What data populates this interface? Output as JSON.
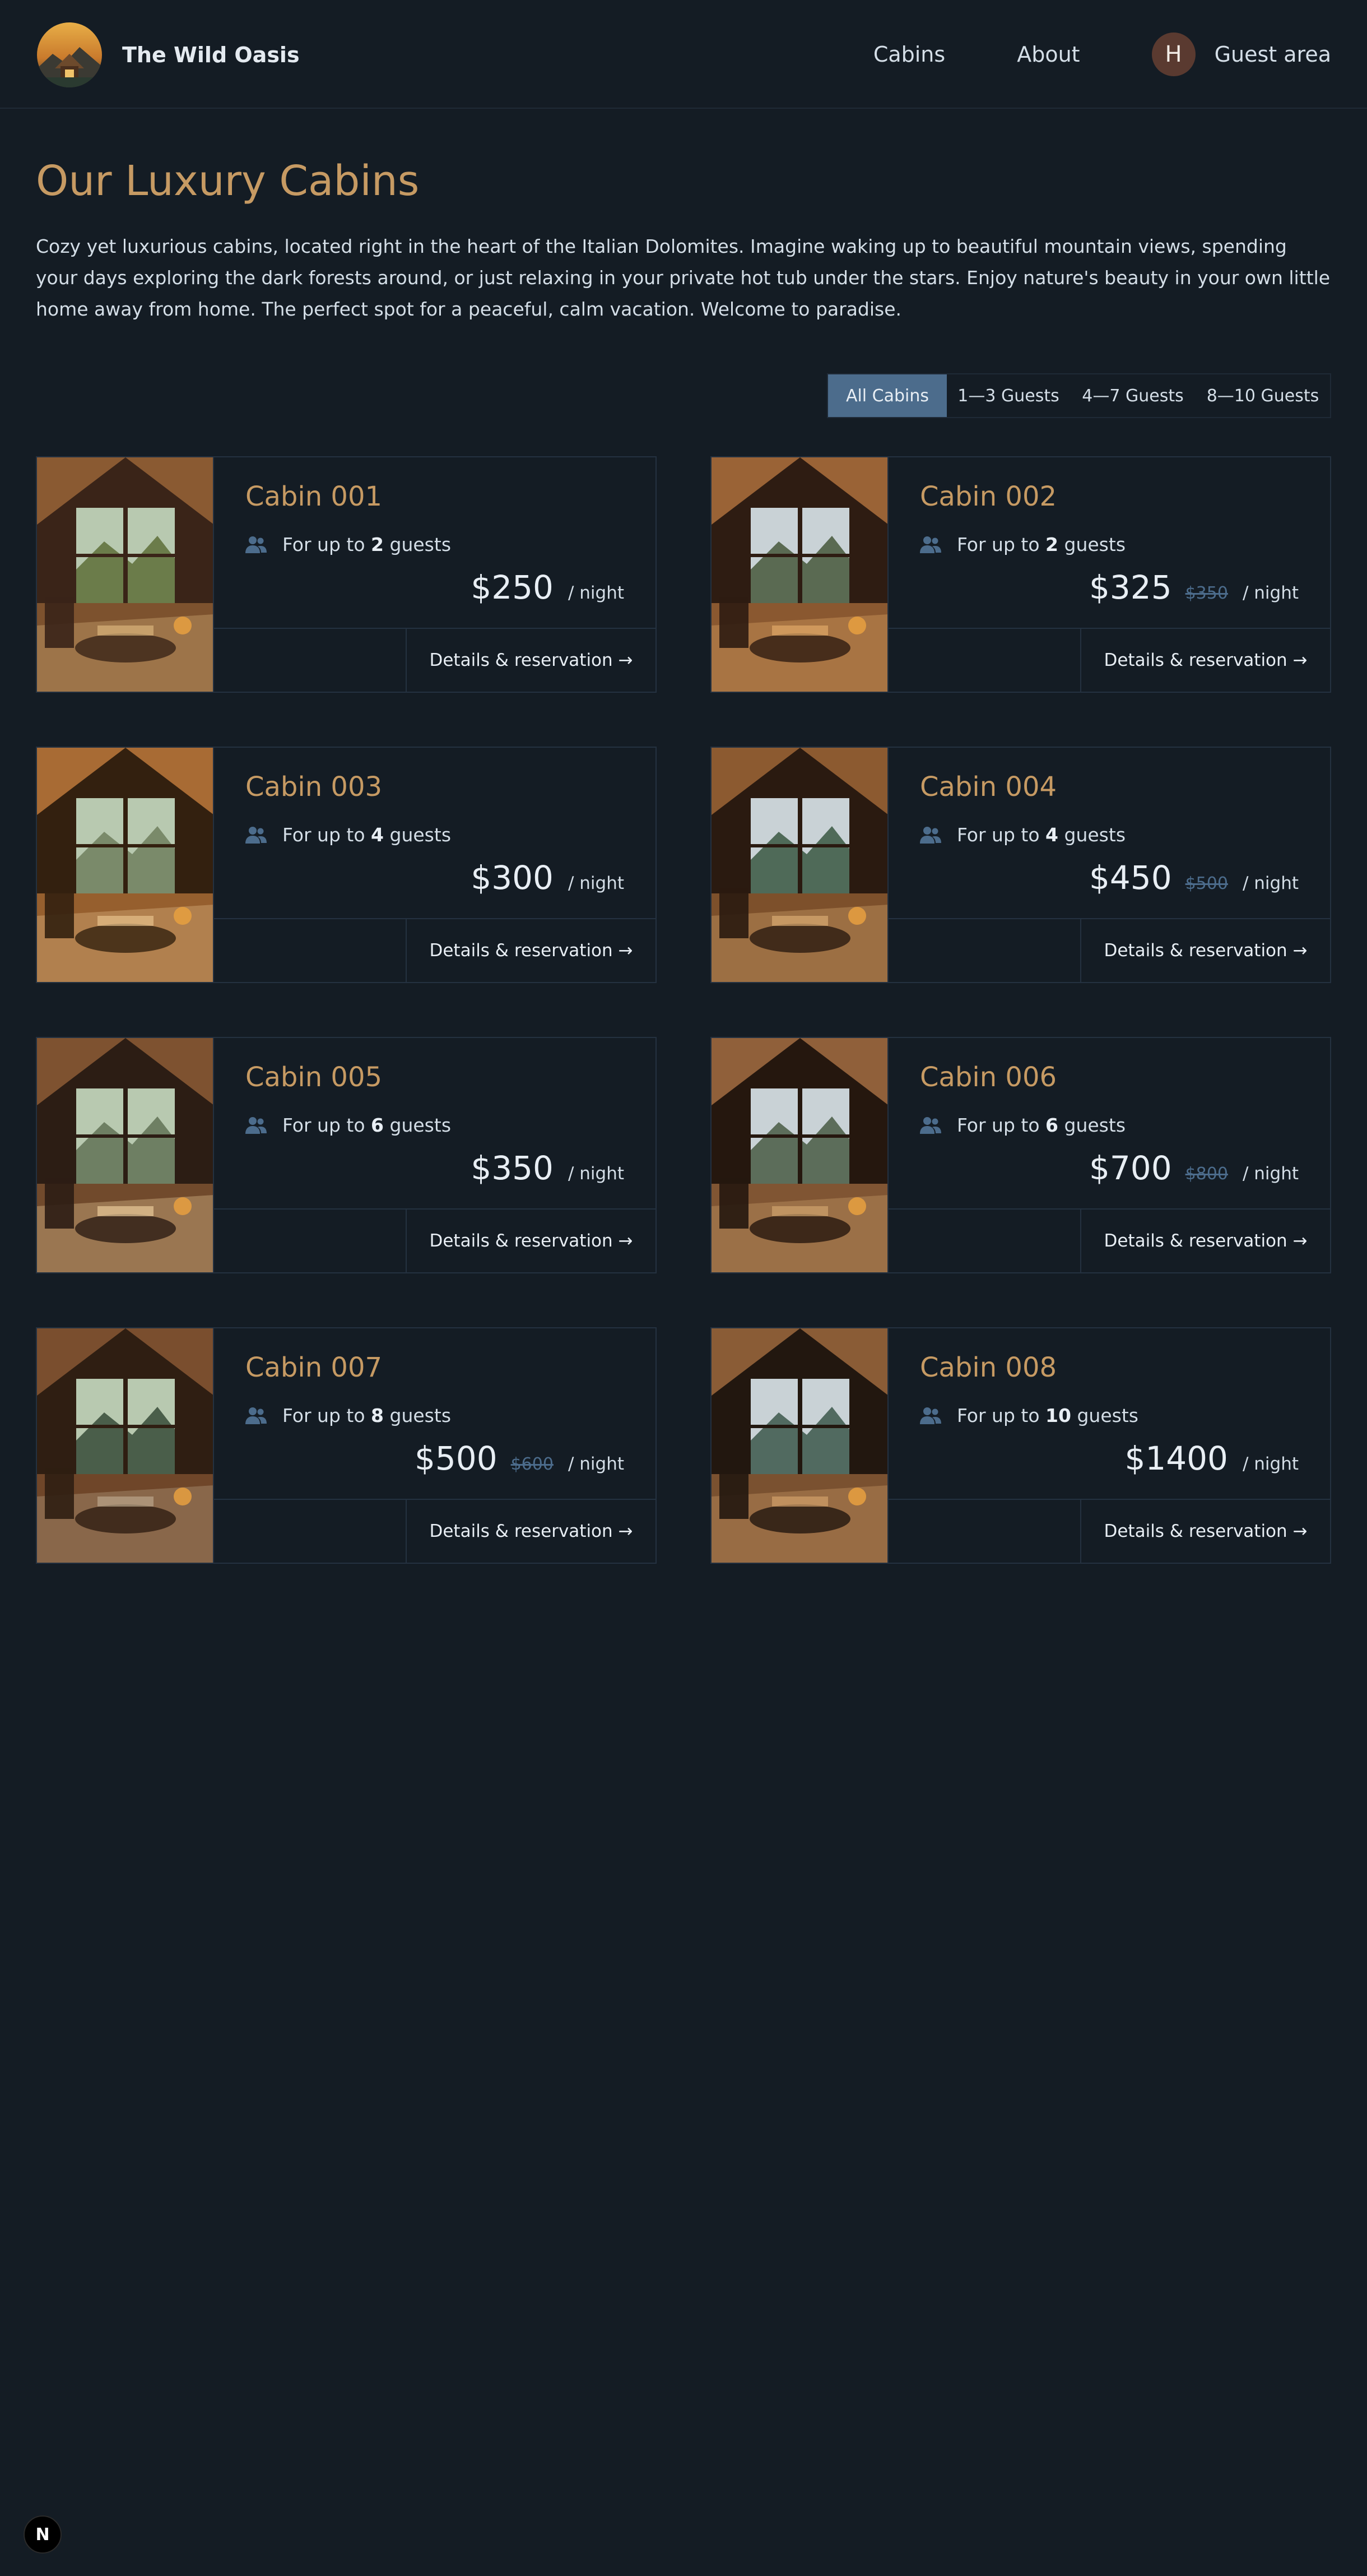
{
  "header": {
    "logo_text": "The Wild Oasis",
    "nav": {
      "cabins": "Cabins",
      "about": "About",
      "guest_area": "Guest area",
      "avatar_initial": "H"
    }
  },
  "main": {
    "title": "Our Luxury Cabins",
    "intro": "Cozy yet luxurious cabins, located right in the heart of the Italian Dolomites. Imagine waking up to beautiful mountain views, spending your days exploring the dark forests around, or just relaxing in your private hot tub under the stars. Enjoy nature's beauty in your own little home away from home. The perfect spot for a peaceful, calm vacation. Welcome to paradise.",
    "filter": {
      "options": [
        "All Cabins",
        "1—3 Guests",
        "4—7 Guests",
        "8—10 Guests"
      ],
      "selected": "All Cabins"
    }
  },
  "cabin_card_labels": {
    "capacity_prefix": "For up to",
    "capacity_suffix": "guests",
    "per_night": "/ night",
    "details_link": "Details & reservation →"
  },
  "cabins": [
    {
      "name": "Cabin 001",
      "guests": "2",
      "price": "$250",
      "old_price": ""
    },
    {
      "name": "Cabin 002",
      "guests": "2",
      "price": "$325",
      "old_price": "$350"
    },
    {
      "name": "Cabin 003",
      "guests": "4",
      "price": "$300",
      "old_price": ""
    },
    {
      "name": "Cabin 004",
      "guests": "4",
      "price": "$450",
      "old_price": "$500"
    },
    {
      "name": "Cabin 005",
      "guests": "6",
      "price": "$350",
      "old_price": ""
    },
    {
      "name": "Cabin 006",
      "guests": "6",
      "price": "$700",
      "old_price": "$800"
    },
    {
      "name": "Cabin 007",
      "guests": "8",
      "price": "$500",
      "old_price": "$600"
    },
    {
      "name": "Cabin 008",
      "guests": "10",
      "price": "$1400",
      "old_price": ""
    }
  ],
  "dev_badge": {
    "label": "N"
  },
  "colors": {
    "background": "#141c24",
    "accent": "#c69a63",
    "filter_active": "#4c6c8c",
    "text": "#d4dee7",
    "border": "#243140"
  }
}
